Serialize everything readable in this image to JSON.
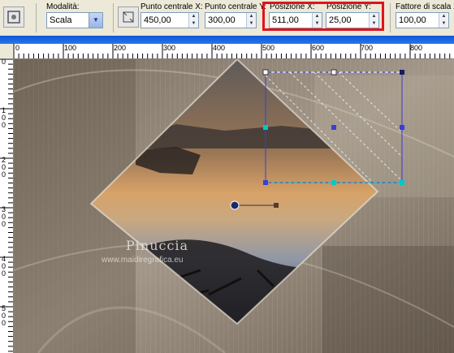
{
  "toolbar": {
    "mode": {
      "label": "Modalità:",
      "value": "Scala"
    },
    "center_x": {
      "label": "Punto centrale X:",
      "value": "450,00"
    },
    "center_y": {
      "label": "Punto centrale Y:",
      "value": "300,00"
    },
    "pos_x": {
      "label": "Posizione X:",
      "value": "511,00"
    },
    "pos_y": {
      "label": "Posizione Y:",
      "value": "25,00"
    },
    "scale": {
      "label": "Fattore di scala X",
      "value": "100,00"
    }
  },
  "colors": {
    "highlight": "#e0141c",
    "selection": "#3c3cd8",
    "handle_cyan": "#00c8c8",
    "background_tone": "#8a7f6e"
  },
  "ruler": {
    "h_labels": [
      "0",
      "100",
      "200",
      "300",
      "400",
      "500",
      "600",
      "700",
      "800"
    ],
    "v_labels": [
      "0",
      "1 0 0",
      "2 0 0",
      "3 0 0",
      "4 0 0",
      "5 0 0"
    ]
  },
  "watermark": {
    "name": "Pinuccia",
    "site": "www.maidiregrafica.eu"
  }
}
